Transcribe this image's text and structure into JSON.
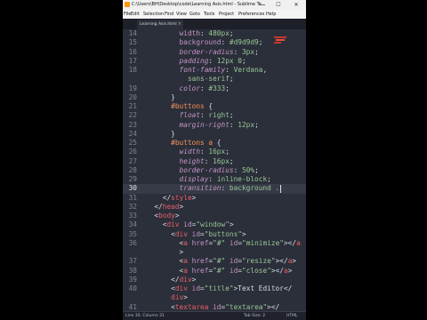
{
  "window": {
    "title": "C:\\Users\\BH\\Desktop\\code\\Learning Asis.html - Sublime Te...",
    "minimize": "—",
    "maximize": "☐",
    "close": "✕"
  },
  "menu": [
    "File",
    "Edit",
    "Selection",
    "Find",
    "View",
    "Goto",
    "Tools",
    "Project",
    "Preferences",
    "Help"
  ],
  "tab": {
    "label": "Learning Asis.html",
    "close": "×"
  },
  "colors": {
    "background": "#2b2f3a",
    "tag": "#ec5f67",
    "property": "#c594c5",
    "value": "#99c794",
    "selector": "#f99157",
    "gutter": "#7e8590",
    "current_line": "#363b47"
  },
  "editor": {
    "current_line": "30",
    "lines": [
      {
        "n": "14",
        "parts": [
          [
            "k",
            "        width"
          ],
          [
            "p",
            ": "
          ],
          [
            "v",
            "480px"
          ],
          [
            "p",
            ";"
          ]
        ]
      },
      {
        "n": "15",
        "parts": [
          [
            "k",
            "        background"
          ],
          [
            "p",
            ": "
          ],
          [
            "v",
            "#d9d9d9"
          ],
          [
            "p",
            ";"
          ]
        ]
      },
      {
        "n": "16",
        "parts": [
          [
            "pk",
            "        border-radius"
          ],
          [
            "p",
            ": "
          ],
          [
            "v",
            "3px"
          ],
          [
            "p",
            ";"
          ]
        ]
      },
      {
        "n": "17",
        "parts": [
          [
            "pk",
            "        padding"
          ],
          [
            "p",
            ": "
          ],
          [
            "v",
            "12px 0"
          ],
          [
            "p",
            ";"
          ]
        ]
      },
      {
        "n": "18",
        "parts": [
          [
            "pk",
            "        font-family"
          ],
          [
            "p",
            ": "
          ],
          [
            "v",
            "Verdana"
          ],
          [
            "p",
            ","
          ]
        ]
      },
      {
        "n": "",
        "parts": [
          [
            "v",
            "          sans-serif"
          ],
          [
            "p",
            ";"
          ]
        ]
      },
      {
        "n": "19",
        "parts": [
          [
            "pk",
            "        color"
          ],
          [
            "p",
            ": "
          ],
          [
            "v",
            "#333"
          ],
          [
            "p",
            ";"
          ]
        ]
      },
      {
        "n": "20",
        "parts": [
          [
            "p",
            "      }"
          ]
        ]
      },
      {
        "n": "21",
        "parts": [
          [
            "sel",
            "      #buttons"
          ],
          [
            "p",
            " {"
          ]
        ]
      },
      {
        "n": "22",
        "parts": [
          [
            "pk",
            "        float"
          ],
          [
            "p",
            ": "
          ],
          [
            "v",
            "right"
          ],
          [
            "p",
            ";"
          ]
        ]
      },
      {
        "n": "23",
        "parts": [
          [
            "pk",
            "        margin-right"
          ],
          [
            "p",
            ": "
          ],
          [
            "v",
            "12px"
          ],
          [
            "p",
            ";"
          ]
        ]
      },
      {
        "n": "24",
        "parts": [
          [
            "p",
            "      }"
          ]
        ]
      },
      {
        "n": "25",
        "parts": [
          [
            "sel",
            "      #buttons a"
          ],
          [
            "p",
            " {"
          ]
        ]
      },
      {
        "n": "26",
        "parts": [
          [
            "pk",
            "        width"
          ],
          [
            "p",
            ": "
          ],
          [
            "v",
            "16px"
          ],
          [
            "p",
            ";"
          ]
        ]
      },
      {
        "n": "27",
        "parts": [
          [
            "pk",
            "        height"
          ],
          [
            "p",
            ": "
          ],
          [
            "v",
            "16px"
          ],
          [
            "p",
            ";"
          ]
        ]
      },
      {
        "n": "28",
        "parts": [
          [
            "pk",
            "        border-radius"
          ],
          [
            "p",
            ": "
          ],
          [
            "v",
            "50%"
          ],
          [
            "p",
            ";"
          ]
        ]
      },
      {
        "n": "29",
        "parts": [
          [
            "pk",
            "        display"
          ],
          [
            "p",
            ": "
          ],
          [
            "v",
            "inline-block"
          ],
          [
            "p",
            ";"
          ]
        ]
      },
      {
        "n": "30",
        "parts": [
          [
            "pk",
            "        transition"
          ],
          [
            "p",
            ": "
          ],
          [
            "v",
            "background ."
          ]
        ]
      },
      {
        "n": "31",
        "parts": [
          [
            "p",
            "    </"
          ],
          [
            "t",
            "style"
          ],
          [
            "p",
            ">"
          ]
        ]
      },
      {
        "n": "32",
        "parts": [
          [
            "p",
            "  </"
          ],
          [
            "t",
            "head"
          ],
          [
            "p",
            ">"
          ]
        ]
      },
      {
        "n": "33",
        "parts": [
          [
            "p",
            "  <"
          ],
          [
            "t",
            "body"
          ],
          [
            "p",
            ">"
          ]
        ]
      },
      {
        "n": "34",
        "parts": [
          [
            "p",
            "    <"
          ],
          [
            "t",
            "div"
          ],
          [
            "a",
            " id"
          ],
          [
            "p",
            "="
          ],
          [
            "s",
            "\"window\""
          ],
          [
            "p",
            ">"
          ]
        ]
      },
      {
        "n": "35",
        "parts": [
          [
            "p",
            "      <"
          ],
          [
            "t",
            "div"
          ],
          [
            "a",
            " id"
          ],
          [
            "p",
            "="
          ],
          [
            "s",
            "\"buttons\""
          ],
          [
            "p",
            ">"
          ]
        ]
      },
      {
        "n": "36",
        "parts": [
          [
            "p",
            "        <"
          ],
          [
            "t",
            "a"
          ],
          [
            "a",
            " href"
          ],
          [
            "p",
            "="
          ],
          [
            "s",
            "\"#\""
          ],
          [
            "a",
            " id"
          ],
          [
            "p",
            "="
          ],
          [
            "s",
            "\"minimize\""
          ],
          [
            "p",
            "></"
          ],
          [
            "t",
            "a"
          ]
        ]
      },
      {
        "n": "",
        "parts": [
          [
            "p",
            "        >"
          ]
        ]
      },
      {
        "n": "37",
        "parts": [
          [
            "p",
            "        <"
          ],
          [
            "t",
            "a"
          ],
          [
            "a",
            " href"
          ],
          [
            "p",
            "="
          ],
          [
            "s",
            "\"#\""
          ],
          [
            "a",
            " id"
          ],
          [
            "p",
            "="
          ],
          [
            "s",
            "\"resize\""
          ],
          [
            "p",
            "></"
          ],
          [
            "t",
            "a"
          ],
          [
            "p",
            ">"
          ]
        ]
      },
      {
        "n": "38",
        "parts": [
          [
            "p",
            "        <"
          ],
          [
            "t",
            "a"
          ],
          [
            "a",
            " href"
          ],
          [
            "p",
            "="
          ],
          [
            "s",
            "\"#\""
          ],
          [
            "a",
            " id"
          ],
          [
            "p",
            "="
          ],
          [
            "s",
            "\"close\""
          ],
          [
            "p",
            "></"
          ],
          [
            "t",
            "a"
          ],
          [
            "p",
            ">"
          ]
        ]
      },
      {
        "n": "39",
        "parts": [
          [
            "p",
            "      </"
          ],
          [
            "t",
            "div"
          ],
          [
            "p",
            ">"
          ]
        ]
      },
      {
        "n": "40",
        "parts": [
          [
            "p",
            "      <"
          ],
          [
            "t",
            "div"
          ],
          [
            "a",
            " id"
          ],
          [
            "p",
            "="
          ],
          [
            "s",
            "\"title\""
          ],
          [
            "p",
            ">Text Editor</"
          ]
        ]
      },
      {
        "n": "",
        "parts": [
          [
            "t",
            "      div"
          ],
          [
            "p",
            ">"
          ]
        ]
      },
      {
        "n": "41",
        "parts": [
          [
            "p",
            "      <"
          ],
          [
            "t",
            "textarea"
          ],
          [
            "a",
            " id"
          ],
          [
            "p",
            "="
          ],
          [
            "s",
            "\"textarea\""
          ],
          [
            "p",
            "></"
          ]
        ]
      }
    ]
  },
  "status": {
    "left": "Line 30, Column 31",
    "tab_size": "Tab Size: 2",
    "syntax": "HTML"
  }
}
